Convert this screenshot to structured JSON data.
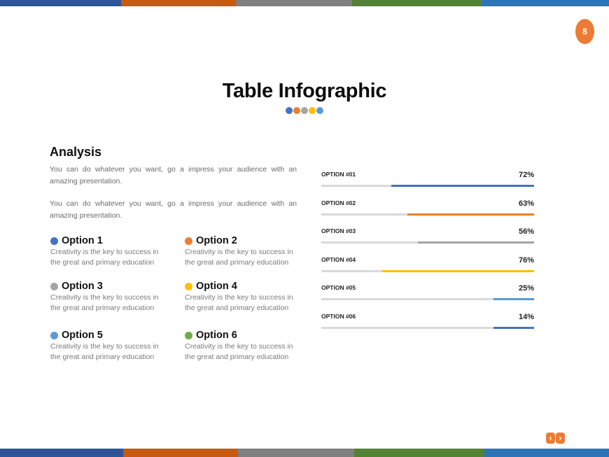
{
  "stripes": {
    "top": [
      "#2f5597",
      "#c55a11",
      "#7f7f7f",
      "#538135",
      "#2e75b6"
    ],
    "bottom": [
      "#2f5597",
      "#c55a11",
      "#7f7f7f",
      "#538135",
      "#2e75b6"
    ]
  },
  "page_number": "8",
  "accent_color": "#ec7c35",
  "title": "Table Infographic",
  "title_dots": [
    "#4472c4",
    "#ed7d31",
    "#a5a5a5",
    "#ffc000",
    "#5b9bd5"
  ],
  "analysis": {
    "heading": "Analysis",
    "paragraphs": [
      "You can do whatever you want, go a impress your audience with an amazing presentation.",
      "You can do whatever you want, go a impress your audience with an amazing presentation."
    ]
  },
  "options": [
    {
      "label": "Option 1",
      "color": "#4472c4",
      "desc": "Creativity is the key to success in the great and primary education"
    },
    {
      "label": "Option 2",
      "color": "#ed7d31",
      "desc": "Creativity is the key to success in the great and primary education"
    },
    {
      "label": "Option 3",
      "color": "#a5a5a5",
      "desc": "Creativity is the key to success in the great and primary education"
    },
    {
      "label": "Option 4",
      "color": "#ffc000",
      "desc": "Creativity is the key to success in the great and primary education"
    },
    {
      "label": "Option 5",
      "color": "#5b9bd5",
      "desc": "Creativity is the key to success in the great and primary education"
    },
    {
      "label": "Option 6",
      "color": "#70ad47",
      "desc": "Creativity is the key to success in the great and primary education"
    }
  ],
  "progress": [
    {
      "label": "OPTION #01",
      "value_text": "72%",
      "fill_fraction": 0.67,
      "color": "#4472c4"
    },
    {
      "label": "OPTION #02",
      "value_text": "63%",
      "fill_fraction": 0.596,
      "color": "#ed7d31"
    },
    {
      "label": "OPTION #03",
      "value_text": "56%",
      "fill_fraction": 0.545,
      "color": "#a5a5a5"
    },
    {
      "label": "OPTION #04",
      "value_text": "76%",
      "fill_fraction": 0.715,
      "color": "#ffc000"
    },
    {
      "label": "OPTION #05",
      "value_text": "25%",
      "fill_fraction": 0.19,
      "color": "#5b9bd5"
    },
    {
      "label": "OPTION #06",
      "value_text": "14%",
      "fill_fraction": 0.19,
      "color": "#4472c4"
    }
  ],
  "nav": {
    "prev": "‹",
    "next": "›"
  }
}
